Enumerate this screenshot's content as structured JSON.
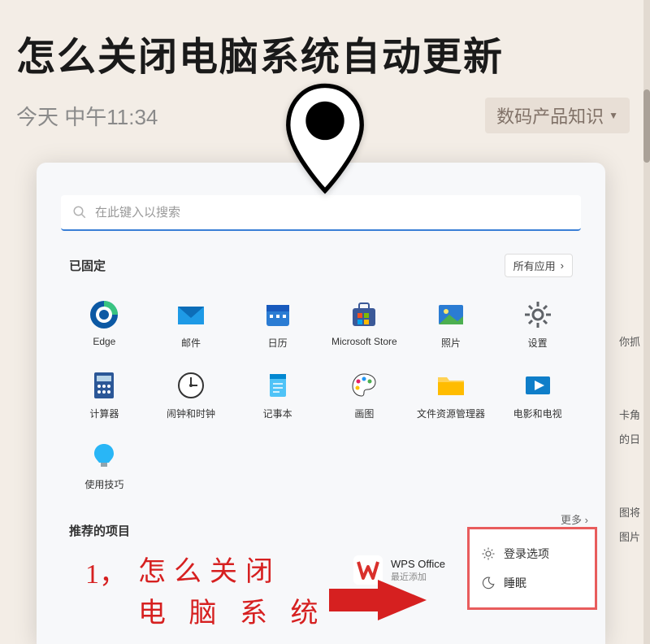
{
  "article": {
    "title": "怎么关闭电脑系统自动更新",
    "timestamp": "今天 中午11:34",
    "category": "数码产品知识"
  },
  "startmenu": {
    "search_placeholder": "在此键入以搜索",
    "pinned_label": "已固定",
    "all_apps_label": "所有应用",
    "apps": [
      {
        "name": "Edge"
      },
      {
        "name": "邮件"
      },
      {
        "name": "日历"
      },
      {
        "name": "Microsoft Store"
      },
      {
        "name": "照片"
      },
      {
        "name": "设置"
      },
      {
        "name": "计算器"
      },
      {
        "name": "闹钟和时钟"
      },
      {
        "name": "记事本"
      },
      {
        "name": "画图"
      },
      {
        "name": "文件资源管理器"
      },
      {
        "name": "电影和电视"
      },
      {
        "name": "使用技巧"
      }
    ],
    "recommended_label": "推荐的项目",
    "more_label": "更多",
    "wps": {
      "title": "WPS Office",
      "subtitle": "最近添加"
    }
  },
  "annotation": {
    "number": "1，",
    "line1": "怎么关闭",
    "line2": "电 脑 系 统"
  },
  "power_menu": {
    "signin": "登录选项",
    "sleep": "睡眠"
  },
  "side_fragments": {
    "a": "你抓",
    "b": "卡角",
    "c": "的日",
    "d": "图将",
    "e": "图片"
  }
}
